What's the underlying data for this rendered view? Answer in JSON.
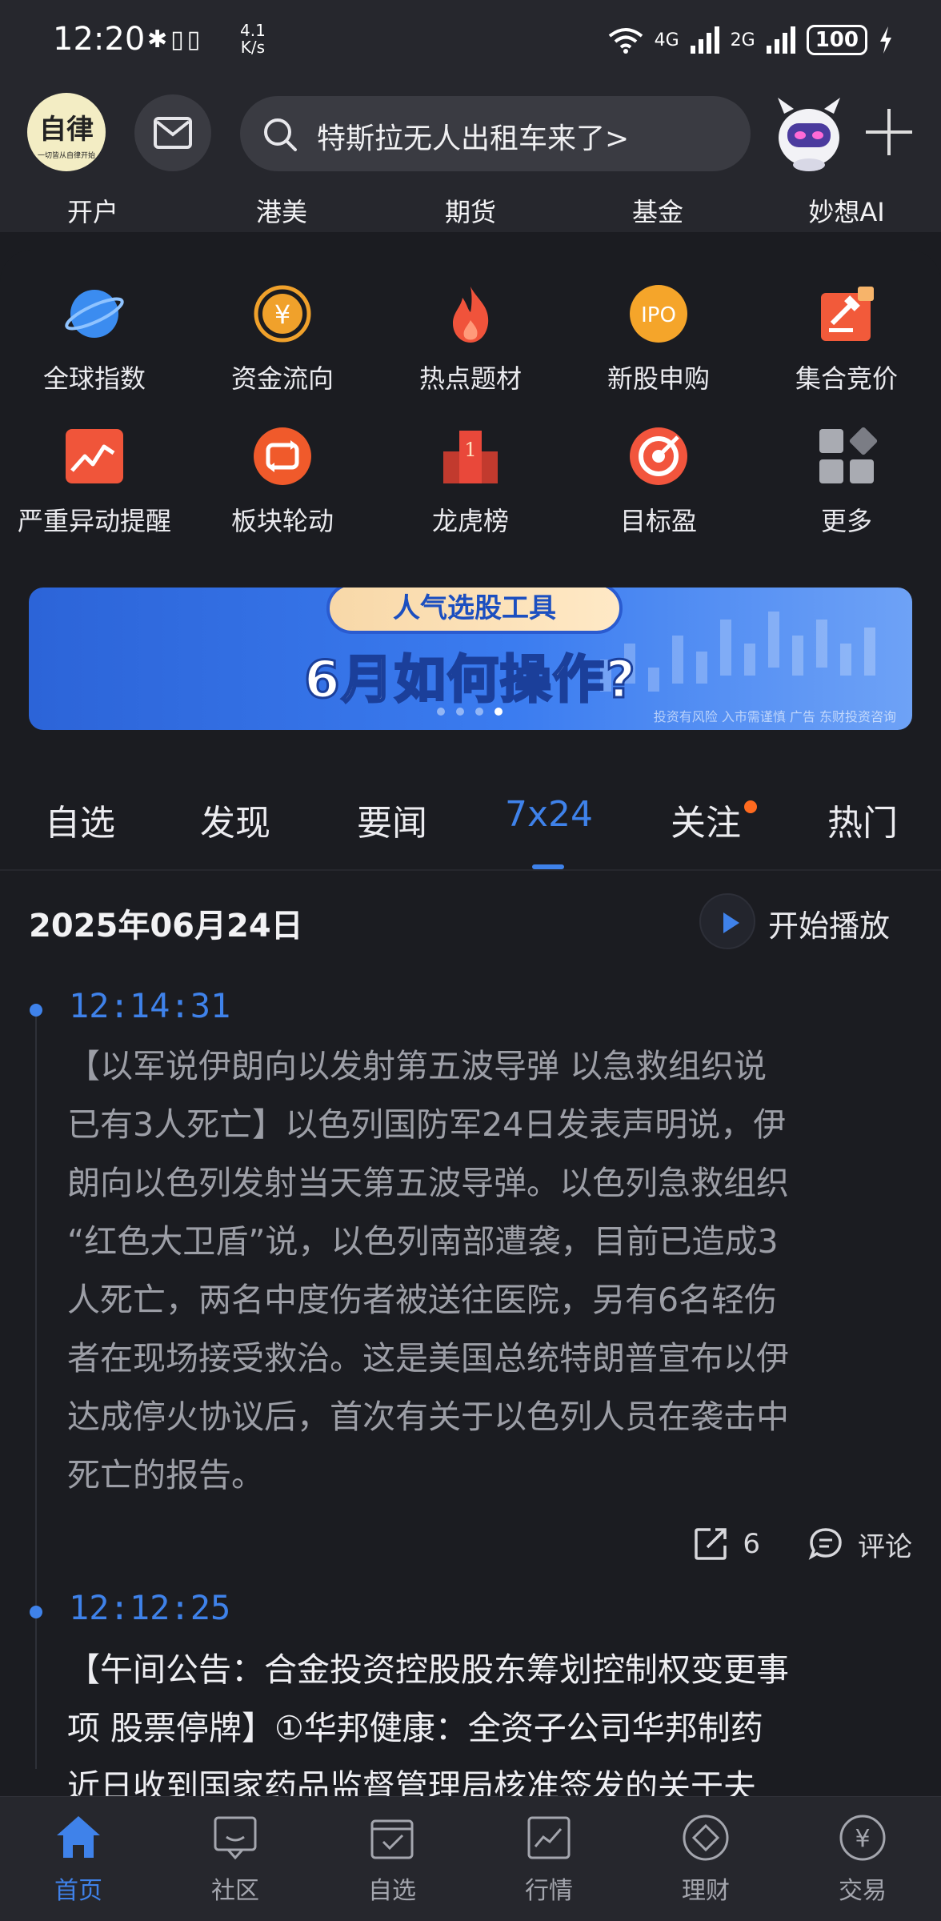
{
  "status_bar": {
    "time": "12:20",
    "speed_value": "4.1",
    "speed_unit": "K/s",
    "network_1": "4G",
    "network_2": "2G",
    "battery": "100"
  },
  "header": {
    "avatar_text": "自律",
    "avatar_subtext": "一切皆从自律开始",
    "search_text": "特斯拉无人出租车来了>",
    "quick_links": [
      "开户",
      "港美",
      "期货",
      "基金",
      "妙想AI"
    ]
  },
  "grid": [
    {
      "label": "全球指数",
      "icon": "planet-icon",
      "color": "#3b8cf0"
    },
    {
      "label": "资金流向",
      "icon": "yuan-coin-icon",
      "color": "#f0a12b"
    },
    {
      "label": "热点题材",
      "icon": "flame-icon",
      "color": "#f0533b"
    },
    {
      "label": "新股申购",
      "icon": "ipo-icon",
      "color": "#f5a52a"
    },
    {
      "label": "集合竞价",
      "icon": "gavel-icon",
      "color": "#f25a3a"
    },
    {
      "label": "严重异动提醒",
      "icon": "trend-alert-icon",
      "color": "#f0553a"
    },
    {
      "label": "板块轮动",
      "icon": "rotate-icon",
      "color": "#f05a2b"
    },
    {
      "label": "龙虎榜",
      "icon": "podium-icon",
      "color": "#e9483a"
    },
    {
      "label": "目标盈",
      "icon": "target-icon",
      "color": "#f2553d"
    },
    {
      "label": "更多",
      "icon": "grid-more-icon",
      "color": "#a9abb2"
    }
  ],
  "banner": {
    "tag": "人气选股工具",
    "title": "6月如何操作?",
    "disclaimer": "投资有风险 入市需谨慎 广告 东财投资咨询",
    "dots_total": 4,
    "dots_active": 4
  },
  "tabs": {
    "items": [
      "自选",
      "发现",
      "要闻",
      "7x24",
      "关注",
      "热门"
    ],
    "active": "7x24"
  },
  "feed": {
    "date": "2025年06月24日",
    "play_label": "开始播放",
    "items": [
      {
        "time": "12:14:31",
        "lines": [
          "【以军说伊朗向以发射第五波导弹 以急救组织说",
          "已有3人死亡】以色列国防军24日发表声明说，伊",
          "朗向以色列发射当天第五波导弹。以色列急救组织",
          "“红色大卫盾”说，以色列南部遭袭，目前已造成3",
          "人死亡，两名中度伤者被送往医院，另有6名轻伤",
          "者在现场接受救治。这是美国总统特朗普宣布以伊",
          "达成停火协议后，首次有关于以色列人员在袭击中",
          "死亡的报告。"
        ],
        "share_count": "6",
        "comment_label": "评论"
      },
      {
        "time": "12:12:25",
        "lines": [
          "【午间公告：合金投资控股股东筹划控制权变更事",
          "项 股票停牌】①华邦健康：全资子公司华邦制药",
          "近日收到国家药品监督管理局核准签发的关于夫"
        ]
      }
    ]
  },
  "bottom_nav": {
    "items": [
      {
        "label": "首页",
        "icon": "home-icon"
      },
      {
        "label": "社区",
        "icon": "chat-icon"
      },
      {
        "label": "自选",
        "icon": "watchlist-icon"
      },
      {
        "label": "行情",
        "icon": "market-chart-icon"
      },
      {
        "label": "理财",
        "icon": "diamond-icon"
      },
      {
        "label": "交易",
        "icon": "yuan-trade-icon"
      }
    ],
    "active": "首页"
  },
  "colors": {
    "accent": "#3f82ea",
    "background": "#1b1c21",
    "header": "#26272d",
    "notification_dot": "#ff6a1f"
  }
}
